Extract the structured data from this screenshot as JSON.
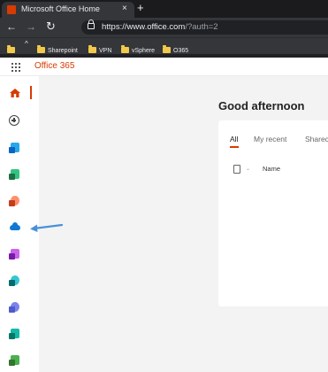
{
  "browser": {
    "tab": {
      "title": "Microsoft Office Home",
      "close_glyph": "×",
      "favicon": "office-favicon"
    },
    "new_tab_glyph": "+",
    "nav": {
      "back_glyph": "←",
      "forward_glyph": "→",
      "reload_glyph": "↻"
    },
    "address": {
      "host": "https://www.office.com",
      "path": "/?auth=2"
    },
    "bookmarks": [
      {
        "label": ""
      },
      {
        "label": "Sharepoint"
      },
      {
        "label": "VPN"
      },
      {
        "label": "vSphere"
      },
      {
        "label": "O365"
      }
    ],
    "bookmarks_overflow_glyph": "^"
  },
  "app": {
    "brand": "Office 365",
    "brand_color": "#d83b01"
  },
  "rail": {
    "items": [
      {
        "name": "home",
        "icon": "home-icon",
        "active": true
      },
      {
        "name": "create",
        "icon": "plus-circle-icon"
      },
      {
        "name": "outlook",
        "icon": "outlook-icon",
        "color": "#0a64c2"
      },
      {
        "name": "excel",
        "icon": "excel-icon",
        "color": "#1d7044"
      },
      {
        "name": "powerpoint",
        "icon": "powerpoint-icon",
        "color": "#c43e1c"
      },
      {
        "name": "onedrive",
        "icon": "onedrive-icon",
        "color": "#0f78d4"
      },
      {
        "name": "onenote",
        "icon": "onenote-icon",
        "color": "#7719aa"
      },
      {
        "name": "sharepoint",
        "icon": "sharepoint-icon",
        "color": "#036c70"
      },
      {
        "name": "teams",
        "icon": "teams-icon",
        "color": "#5059c9"
      },
      {
        "name": "sway",
        "icon": "sway-icon",
        "color": "#077568"
      },
      {
        "name": "project",
        "icon": "project-icon",
        "color": "#31752f"
      }
    ],
    "pointer_arrow_color": "#4a90d9"
  },
  "main": {
    "greeting": "Good afternoon",
    "tabs": [
      {
        "label": "All",
        "active": true
      },
      {
        "label": "My recent"
      },
      {
        "label": "Sharec"
      }
    ],
    "table": {
      "sort_glyph": "⌄",
      "columns": [
        "Name"
      ]
    }
  }
}
